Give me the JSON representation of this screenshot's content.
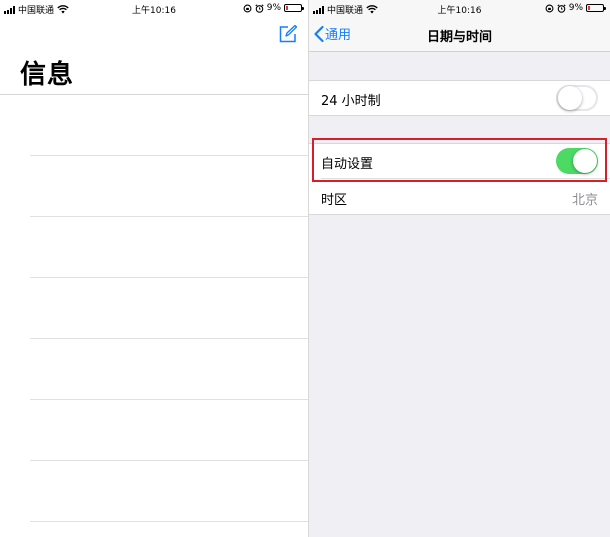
{
  "status_bar": {
    "carrier": "中国联通",
    "time": "上午10:16",
    "battery": "9%",
    "battery_color": "#e0342e"
  },
  "messages_screen": {
    "title": "信息",
    "compose_icon": "compose-icon",
    "empty_row_count": 7
  },
  "datetime_screen": {
    "back_label": "通用",
    "title": "日期与时间",
    "accent_color": "#147efb",
    "toggle_on_color": "#4cd964",
    "highlight_color": "#d81e2b",
    "settings": [
      {
        "label": "24 小时制",
        "type": "toggle",
        "state": "off"
      },
      {
        "label": "自动设置",
        "type": "toggle",
        "state": "on",
        "highlighted": true
      },
      {
        "label": "时区",
        "type": "value",
        "value": "北京"
      }
    ]
  }
}
